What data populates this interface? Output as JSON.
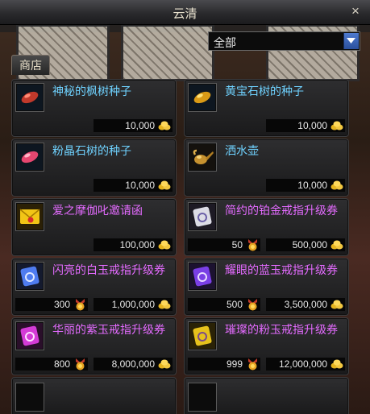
{
  "window": {
    "title": "云清",
    "close_label": "×"
  },
  "filter": {
    "selected": "全部"
  },
  "tabs": [
    {
      "label": "商店"
    }
  ],
  "items": [
    {
      "name": "神秘的枫树种子",
      "name_color": "cyan",
      "icon": "red-seed-icon",
      "price": "10,000",
      "currency_icon": "gold-coin-icon"
    },
    {
      "name": "黄宝石树的种子",
      "name_color": "cyan",
      "icon": "yellow-seed-icon",
      "price": "10,000",
      "currency_icon": "gold-coin-icon"
    },
    {
      "name": "粉晶石树的种子",
      "name_color": "cyan",
      "icon": "pink-seed-icon",
      "price": "10,000",
      "currency_icon": "gold-coin-icon"
    },
    {
      "name": "洒水壶",
      "name_color": "cyan",
      "icon": "watering-can-icon",
      "price": "10,000",
      "currency_icon": "gold-coin-icon"
    },
    {
      "name": "爱之摩伽叱邀请函",
      "name_color": "purple",
      "icon": "invitation-letter-icon",
      "price": "100,000",
      "currency_icon": "gold-coin-icon"
    },
    {
      "name": "简约的铂金戒指升级券",
      "name_color": "purple",
      "icon": "silver-ticket-icon",
      "token_cost": "50",
      "price": "500,000",
      "currency_icon": "gold-coin-icon",
      "token_icon": "medal-icon"
    },
    {
      "name": "闪亮的白玉戒指升级券",
      "name_color": "purple",
      "icon": "blue-ticket-icon",
      "token_cost": "300",
      "price": "1,000,000",
      "currency_icon": "gold-coin-icon",
      "token_icon": "medal-icon"
    },
    {
      "name": "耀眼的蓝玉戒指升级券",
      "name_color": "purple",
      "icon": "violet-ticket-icon",
      "token_cost": "500",
      "price": "3,500,000",
      "currency_icon": "gold-coin-icon",
      "token_icon": "medal-icon"
    },
    {
      "name": "华丽的紫玉戒指升级券",
      "name_color": "purple",
      "icon": "magenta-ticket-icon",
      "token_cost": "800",
      "price": "8,000,000",
      "currency_icon": "gold-coin-icon",
      "token_icon": "medal-icon"
    },
    {
      "name": "璀璨的粉玉戒指升级券",
      "name_color": "purple",
      "icon": "gold-ticket-icon",
      "token_cost": "999",
      "price": "12,000,000",
      "currency_icon": "gold-coin-icon",
      "token_icon": "medal-icon"
    }
  ],
  "colors": {
    "cyan_name": "#6fd2ff",
    "purple_name": "#e46bff",
    "accent": "#2a4f9c"
  }
}
